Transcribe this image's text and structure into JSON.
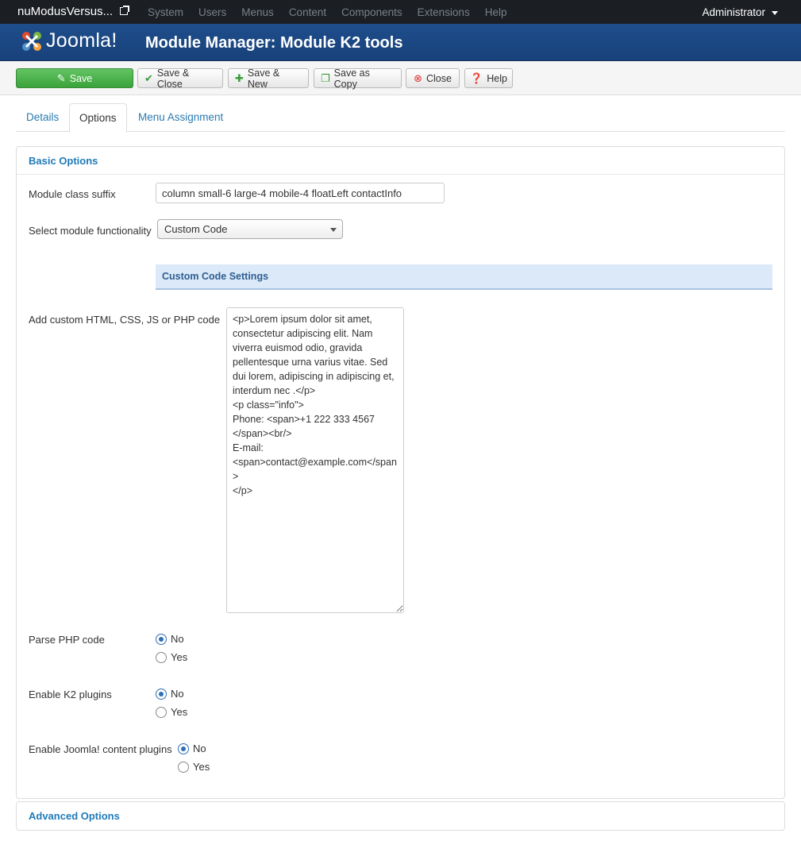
{
  "navbar": {
    "site_name": "nuModusVersus...",
    "menu": [
      "System",
      "Users",
      "Menus",
      "Content",
      "Components",
      "Extensions",
      "Help"
    ],
    "user": "Administrator"
  },
  "header": {
    "logo_text": "Joomla!",
    "title": "Module Manager: Module K2 tools"
  },
  "toolbar": {
    "save": "Save",
    "save_close": "Save & Close",
    "save_new": "Save & New",
    "save_copy": "Save as Copy",
    "close": "Close",
    "help": "Help"
  },
  "tabs": [
    "Details",
    "Options",
    "Menu Assignment"
  ],
  "basic_options": {
    "heading": "Basic Options",
    "class_suffix_label": "Module class suffix",
    "class_suffix_value": "column small-6 large-4 mobile-4 floatLeft contactInfo",
    "functionality_label": "Select module functionality",
    "functionality_value": "Custom Code",
    "custom_code_heading": "Custom Code Settings",
    "custom_code_label": "Add custom HTML, CSS, JS or PHP code",
    "custom_code_value": "<p>Lorem ipsum dolor sit amet, consectetur adipiscing elit. Nam viverra euismod odio, gravida pellentesque urna varius vitae. Sed dui lorem, adipiscing in adipiscing et, interdum nec .</p>\n<p class=\"info\">\nPhone: <span>+1 222 333 4567 </span><br/>\nE-mail: <span>contact@example.com</span>\n</p>",
    "parse_php_label": "Parse PHP code",
    "k2_plugins_label": "Enable K2 plugins",
    "joomla_plugins_label": "Enable Joomla! content plugins",
    "option_no": "No",
    "option_yes": "Yes"
  },
  "advanced_options": {
    "heading": "Advanced Options"
  }
}
